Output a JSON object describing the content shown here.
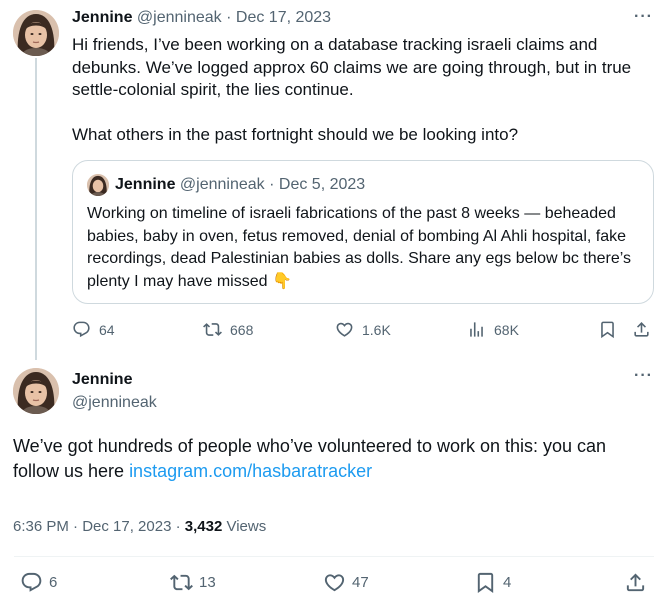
{
  "tweet1": {
    "name": "Jennine",
    "handle": "@jennineak",
    "date": "· Dec 17, 2023",
    "more": "···",
    "text": "Hi friends, I’ve been working on a database tracking israeli claims and debunks. We’ve logged approx 60 claims we are going through, but in true settle-colonial spirit, the lies continue.\n\nWhat others in the past fortnight should we be looking into?",
    "quote": {
      "name": "Jennine",
      "handle": "@jennineak",
      "date": "· Dec 5, 2023",
      "text": "Working on timeline of israeli fabrications of the past 8 weeks — beheaded babies, baby in oven, fetus removed, denial of bombing Al Ahli hospital, fake recordings, dead Palestinian babies as dolls. Share any egs below bc there’s plenty I may have missed",
      "emoji": "👇"
    },
    "actions": {
      "replies": "64",
      "retweets": "668",
      "likes": "1.6K",
      "views": "68K"
    }
  },
  "tweet2": {
    "name": "Jennine",
    "handle": "@jennineak",
    "more": "···",
    "text_before_link": "We’ve got hundreds of people who’ve volunteered to work on this: you can follow us here ",
    "link": "instagram.com/hasbaratracker",
    "timestamp": "6:36 PM · Dec 17, 2023 · ",
    "views_count": "3,432",
    "views_label": " Views",
    "actions": {
      "replies": "6",
      "retweets": "13",
      "likes": "47",
      "bookmarks": "4"
    }
  },
  "colors": {
    "text": "#0f1419",
    "secondary": "#536471",
    "link": "#1d9bf0",
    "border": "#cfd9de"
  }
}
